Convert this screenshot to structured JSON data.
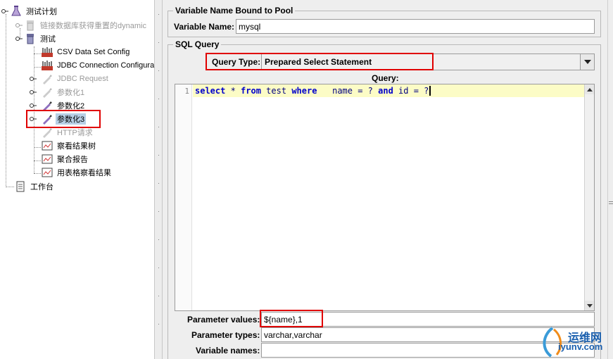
{
  "tree": {
    "items": [
      {
        "label": "测试计划",
        "icon": "flask-icon",
        "disabled": false
      },
      {
        "label": "链接数据库获得重置的dynamic",
        "icon": "thread-group-icon",
        "disabled": true
      },
      {
        "label": "测试",
        "icon": "thread-group-icon",
        "disabled": false
      },
      {
        "label": "CSV Data Set Config",
        "icon": "config-icon",
        "disabled": false
      },
      {
        "label": "JDBC Connection Configurat",
        "icon": "config-icon",
        "disabled": false
      },
      {
        "label": "JDBC Request",
        "icon": "sampler-pipette-icon",
        "disabled": true
      },
      {
        "label": "参数化1",
        "icon": "sampler-pipette-icon",
        "disabled": true
      },
      {
        "label": "参数化2",
        "icon": "sampler-pipette-icon",
        "disabled": false
      },
      {
        "label": "参数化3",
        "icon": "sampler-pipette-icon",
        "disabled": false,
        "selected": true
      },
      {
        "label": "HTTP请求",
        "icon": "sampler-pipette-icon",
        "disabled": true
      },
      {
        "label": "察看结果树",
        "icon": "listener-icon",
        "disabled": false
      },
      {
        "label": "聚合报告",
        "icon": "listener-icon",
        "disabled": false
      },
      {
        "label": "用表格察看结果",
        "icon": "listener-icon",
        "disabled": false
      },
      {
        "label": "工作台",
        "icon": "workbench-icon",
        "disabled": false
      }
    ]
  },
  "pool_group": {
    "title": "Variable Name Bound to Pool",
    "variable_name_label": "Variable Name:",
    "variable_name_value": "mysql"
  },
  "sql_group": {
    "title": "SQL Query",
    "query_type_label": "Query Type:",
    "query_type_value": "Prepared Select Statement",
    "query_label": "Query:",
    "line_number": "1",
    "code": {
      "kw_select": "select",
      "star": " * ",
      "kw_from": "from",
      "table": " test ",
      "kw_where": "where",
      "rest1": "   name = ? ",
      "kw_and": "and",
      "rest2": " id = ?"
    }
  },
  "params": {
    "values_label": "Parameter values:",
    "values_value": "${name},1",
    "types_label": "Parameter types:",
    "types_value": "varchar,varchar",
    "names_label": "Variable names:",
    "names_value": ""
  },
  "watermark": {
    "text_cn": "运维网",
    "text_url": "iyunv.com"
  },
  "colors": {
    "highlight_box": "#e00000",
    "selected_bg": "#b8cfe5",
    "code_line_bg": "#fcfcc6",
    "keyword": "#0000cc"
  }
}
